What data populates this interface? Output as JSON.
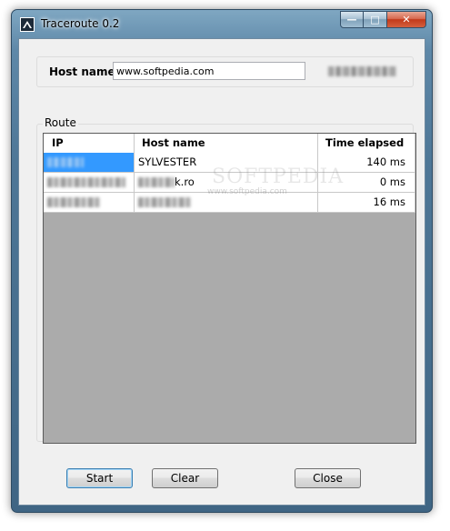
{
  "window": {
    "title": "Traceroute 0.2",
    "caption_buttons": {
      "minimize": "—",
      "maximize": "□",
      "close": "✕"
    }
  },
  "host": {
    "label": "Host name",
    "value": "www.softpedia.com"
  },
  "route": {
    "group_label": "Route",
    "columns": [
      "IP",
      "Host name",
      "Time elapsed"
    ],
    "rows": [
      {
        "ip": "",
        "host": "SYLVESTER",
        "time": "140 ms",
        "selected": true
      },
      {
        "ip": "",
        "host": "k.ro",
        "time": "0 ms",
        "selected": false
      },
      {
        "ip": "",
        "host": "",
        "time": "16 ms",
        "selected": false
      }
    ]
  },
  "buttons": {
    "start": "Start",
    "clear": "Clear",
    "close": "Close"
  },
  "watermark": {
    "main": "SOFTPEDIA",
    "sub": "www.softpedia.com"
  },
  "colors": {
    "selection": "#3399ff",
    "table_background": "#ababab",
    "dialog_background": "#f0f0f0"
  }
}
